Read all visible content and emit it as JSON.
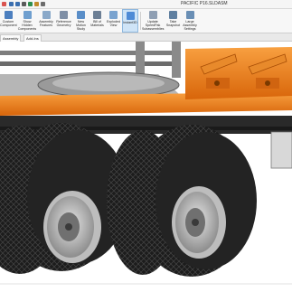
{
  "titlebar": {
    "document_title": "PACIFIC P16.SLDASM",
    "quick_access_colors": [
      "#d9534f",
      "#3a6fb0",
      "#3a6fb0",
      "#5a5a5a",
      "#2f8f4e",
      "#c08a2b",
      "#6b6b6b"
    ]
  },
  "ribbon": {
    "buttons": [
      {
        "label": "Custom\nComponent",
        "icon": "custom-component-icon",
        "color": "#4c7fbf"
      },
      {
        "label": "Show\nHidden\nComponents",
        "icon": "show-hidden-icon",
        "color": "#6f9fcf"
      },
      {
        "label": "Assembly\nFeatures",
        "icon": "assembly-features-icon",
        "color": "#8aa9c9"
      },
      {
        "label": "Reference\nGeometry",
        "icon": "reference-geometry-icon",
        "color": "#7f8fa6"
      },
      {
        "label": "New\nMotion\nStudy",
        "icon": "motion-study-icon",
        "color": "#5a8ec8"
      },
      {
        "label": "Bill of\nMaterials",
        "icon": "bom-icon",
        "color": "#6c7f95"
      },
      {
        "label": "Exploded\nView",
        "icon": "exploded-view-icon",
        "color": "#7aa3cf"
      },
      {
        "label": "Instant3D",
        "icon": "instant3d-icon",
        "color": "#4f8bd6"
      },
      {
        "label": "Update\nSpeedPak\nSubassemblies",
        "icon": "speedpak-icon",
        "color": "#8f9fb3"
      },
      {
        "label": "Take\nSnapshot",
        "icon": "snapshot-icon",
        "color": "#5f7fa0"
      },
      {
        "label": "Large\nAssembly\nSettings",
        "icon": "large-assembly-icon",
        "color": "#6a8fb5"
      }
    ]
  },
  "tabs": [
    {
      "label": "Assembly"
    },
    {
      "label": "Add-Ins"
    }
  ],
  "colors": {
    "frame_orange": "#f07d10",
    "tire": "#1e1e1e",
    "rim": "#c9c9c9",
    "chassis": "#2a2a2a"
  }
}
